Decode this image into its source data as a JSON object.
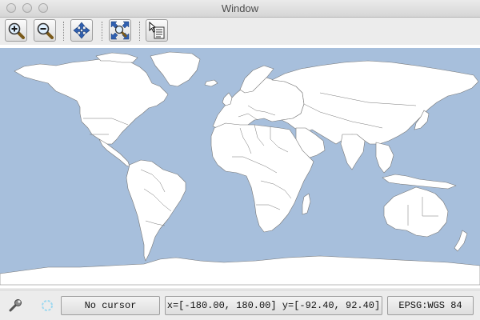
{
  "window": {
    "title": "Window"
  },
  "toolbar": {
    "buttons": [
      {
        "name": "zoom-in",
        "icon": "zoom-in-icon"
      },
      {
        "name": "zoom-out",
        "icon": "zoom-out-icon"
      },
      {
        "name": "pan",
        "icon": "pan-arrows-icon"
      },
      {
        "name": "zoom-full-extent",
        "icon": "zoom-extent-icon"
      },
      {
        "name": "info",
        "icon": "info-cursor-icon"
      }
    ]
  },
  "map": {
    "ocean_color": "#a7bfdc",
    "land_color": "#ffffff",
    "border_color": "#777777"
  },
  "status": {
    "cursor": "No cursor",
    "bounds": "x=[-180.00, 180.00] y=[-92.40, 92.40]",
    "crs": "EPSG:WGS 84"
  }
}
